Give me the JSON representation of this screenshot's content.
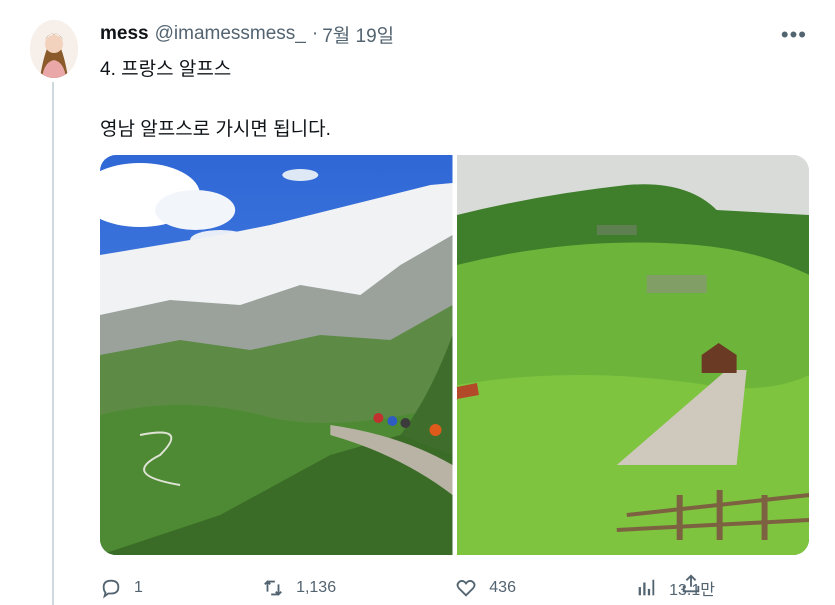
{
  "tweet": {
    "author_name": "mess",
    "author_handle": "@imamessmess_",
    "separator": "·",
    "date": "7월 19일",
    "more_label": "•••",
    "text_line1": "4. 프랑스 알프스",
    "text_line2": "영남 알프스로 가시면 됩니다.",
    "media": [
      {
        "name": "alps-mountain-bikers-photo"
      },
      {
        "name": "green-hillside-photo"
      }
    ]
  },
  "actions": {
    "reply_count": "1",
    "retweet_count": "1,136",
    "like_count": "436",
    "view_count": "13.1만"
  },
  "colors": {
    "text": "#0f1419",
    "muted": "#536471",
    "thread_line": "#cfd9de"
  }
}
